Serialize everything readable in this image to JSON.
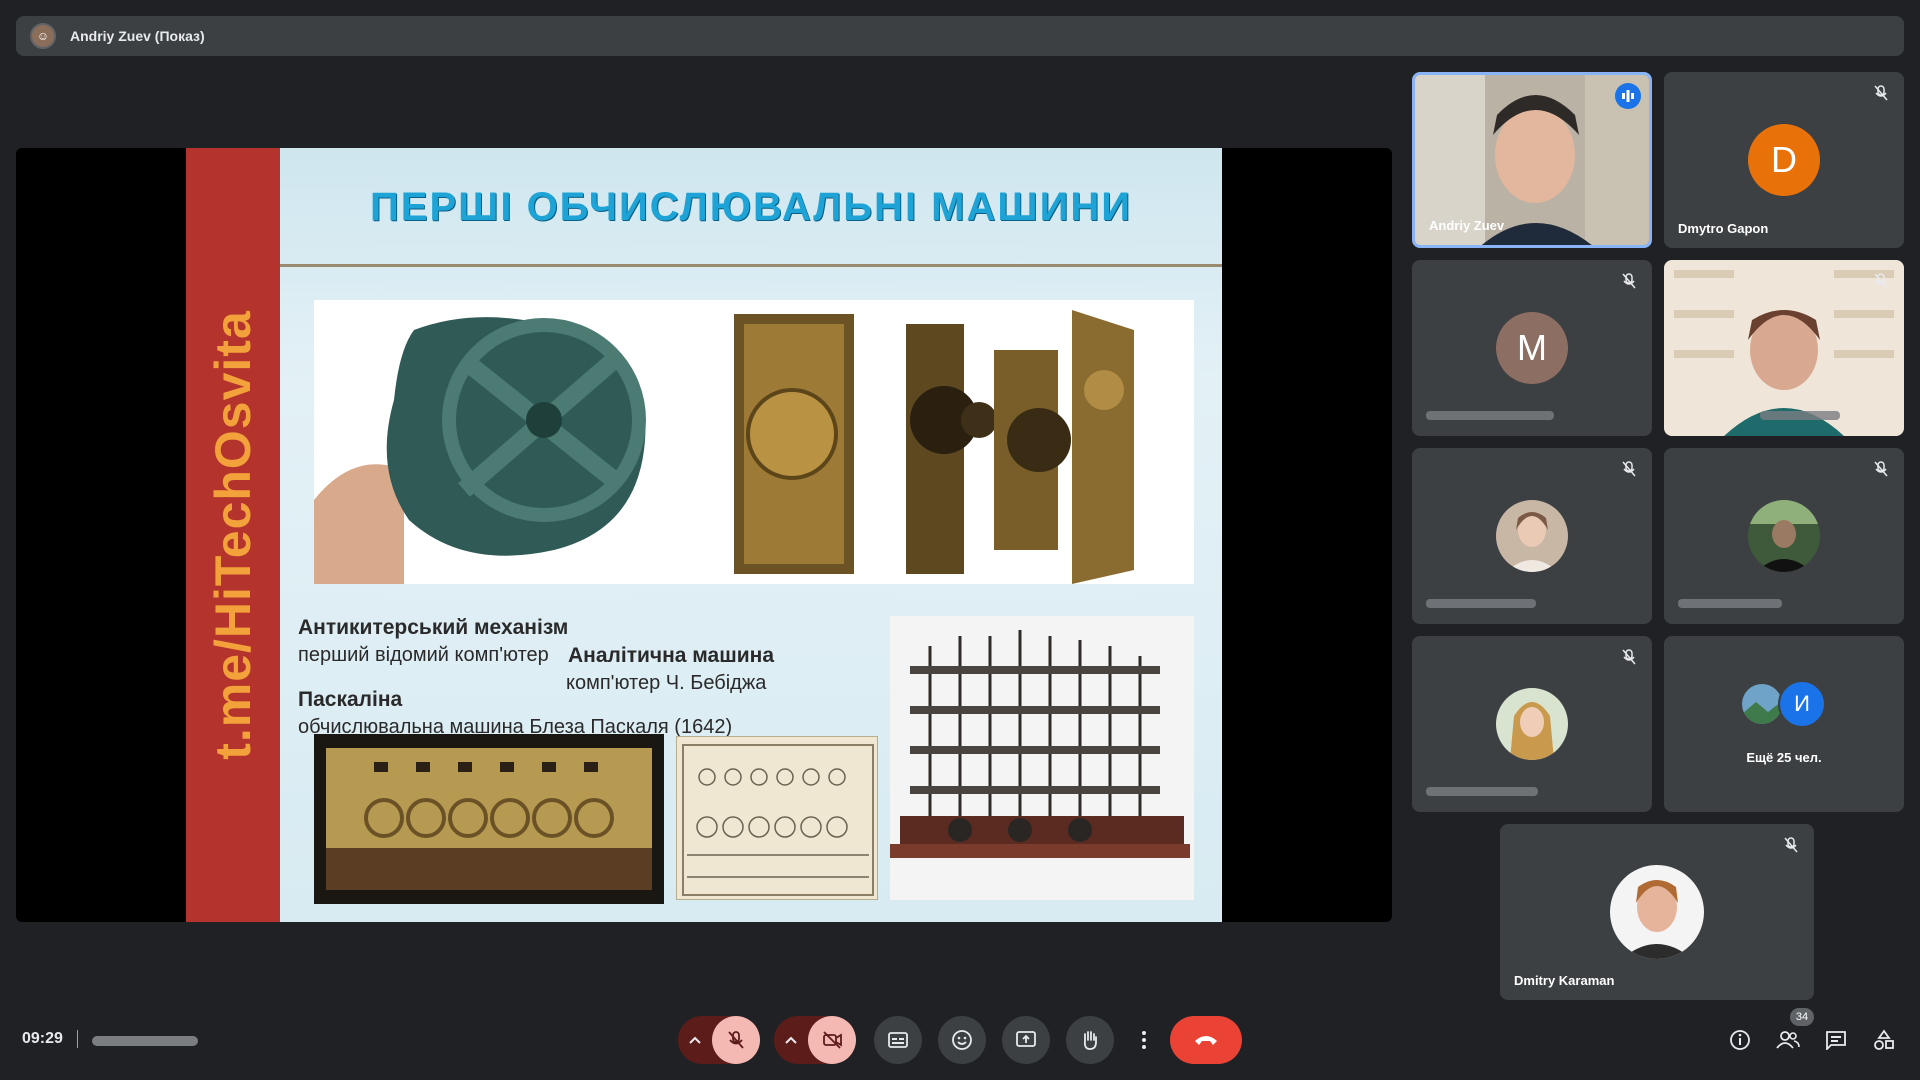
{
  "header": {
    "presenter_title": "Andriy Zuev (Показ)"
  },
  "slide": {
    "side_text": "t.me/HiTechOsvita",
    "heading": "ПЕРШІ ОБЧИСЛЮВАЛЬНІ МАШИНИ",
    "caption1_title": "Антикитерський механізм",
    "caption1_sub": "перший відомий комп'ютер",
    "caption2_title": "Аналітична машина",
    "caption2_sub": "комп'ютер Ч. Бебіджа",
    "caption3_title": "Паскаліна",
    "caption3_sub": "обчислювальна машина Блеза Паскаля (1642)"
  },
  "participants": [
    {
      "name": "Andriy Zuev",
      "type": "video",
      "speaking": true
    },
    {
      "name": "Dmytro Gapon",
      "type": "letter",
      "letter": "D",
      "color": "#e8710a"
    },
    {
      "name": "",
      "type": "letter",
      "letter": "M",
      "color": "#8d6e63"
    },
    {
      "name": "",
      "type": "video"
    },
    {
      "name": "",
      "type": "photo"
    },
    {
      "name": "",
      "type": "photo"
    },
    {
      "name": "",
      "type": "photo"
    },
    {
      "name": "Ещё 25 чел.",
      "type": "more",
      "letter": "И",
      "color": "#1a73e8"
    },
    {
      "name": "Dmitry Karaman",
      "type": "photo"
    }
  ],
  "toolbar": {
    "time": "09:29",
    "participants_count": "34",
    "buttons": [
      "mic-options",
      "mic",
      "camera-options",
      "camera",
      "captions",
      "reactions",
      "present",
      "raise-hand",
      "more",
      "leave-call"
    ]
  },
  "colors": {
    "bg": "#202124",
    "tile": "#3c4043",
    "end_call": "#ea4335",
    "muted_btn": "#f5b9b4",
    "speaking": "#8ab4f8"
  }
}
